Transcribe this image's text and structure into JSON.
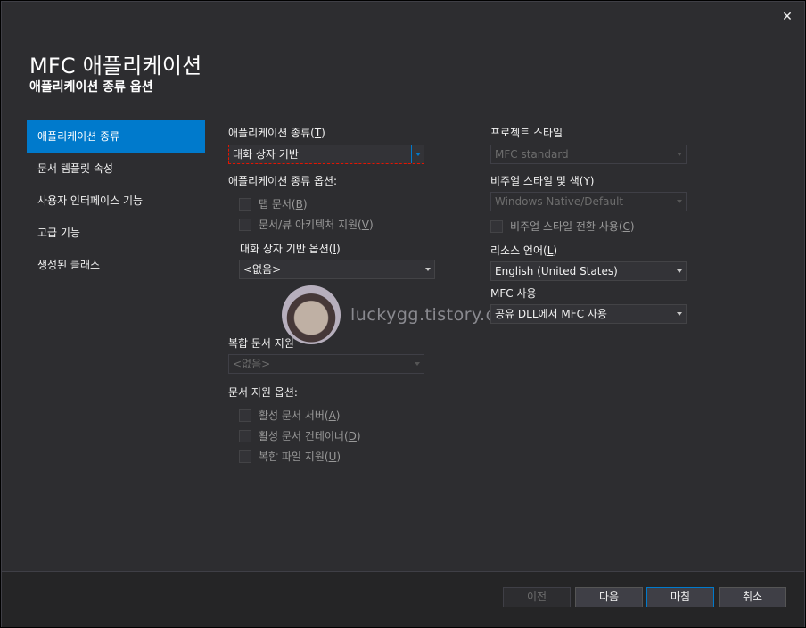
{
  "dialog": {
    "close_label": "✕",
    "title": "MFC 애플리케이션",
    "subtitle": "애플리케이션 종류 옵션"
  },
  "nav": {
    "items": [
      {
        "label": "애플리케이션 종류",
        "active": true
      },
      {
        "label": "문서 템플릿 속성"
      },
      {
        "label": "사용자 인터페이스 기능"
      },
      {
        "label": "고급 기능"
      },
      {
        "label": "생성된 클래스"
      }
    ]
  },
  "app_type": {
    "label_pre": "애플리케이션 종류(",
    "label_key": "T",
    "label_post": ")",
    "value": "대화 상자 기반",
    "options_label": "애플리케이션 종류 옵션:",
    "tabbed_pre": "탭 문서(",
    "tabbed_key": "B",
    "tabbed_post": ")",
    "docview_pre": "문서/뷰 아키텍처 지원(",
    "docview_key": "V",
    "docview_post": ")",
    "dialog_opts_pre": "대화 상자 기반 옵션(",
    "dialog_opts_key": "I",
    "dialog_opts_post": ")",
    "dialog_opts_value": "<없음>"
  },
  "compound": {
    "label": "복합 문서 지원",
    "value": "<없음>",
    "doc_support_label": "문서 지원 옵션:",
    "active_server_pre": "활성 문서 서버(",
    "active_server_key": "A",
    "active_server_post": ")",
    "active_container_pre": "활성 문서 컨테이너(",
    "active_container_key": "D",
    "active_container_post": ")",
    "compound_file_pre": "복합 파일 지원(",
    "compound_file_key": "U",
    "compound_file_post": ")"
  },
  "right": {
    "project_style_label": "프로젝트 스타일",
    "project_style_value": "MFC standard",
    "visual_style_pre": "비주얼 스타일 및 색(",
    "visual_style_key": "Y",
    "visual_style_post": ")",
    "visual_style_value": "Windows Native/Default",
    "visual_switch_pre": "비주얼 스타일 전환 사용(",
    "visual_switch_key": "C",
    "visual_switch_post": ")",
    "resource_lang_pre": "리소스 언어(",
    "resource_lang_key": "L",
    "resource_lang_post": ")",
    "resource_lang_value": "English (United States)",
    "mfc_use_label": "MFC 사용",
    "mfc_use_value": "공유 DLL에서 MFC 사용"
  },
  "watermark": {
    "text": "luckygg.tistory.com"
  },
  "footer": {
    "prev": "이전",
    "next": "다음",
    "finish": "마침",
    "cancel": "취소"
  },
  "colors": {
    "accent": "#007acc",
    "background": "#2d2d30",
    "footer": "#252526"
  }
}
